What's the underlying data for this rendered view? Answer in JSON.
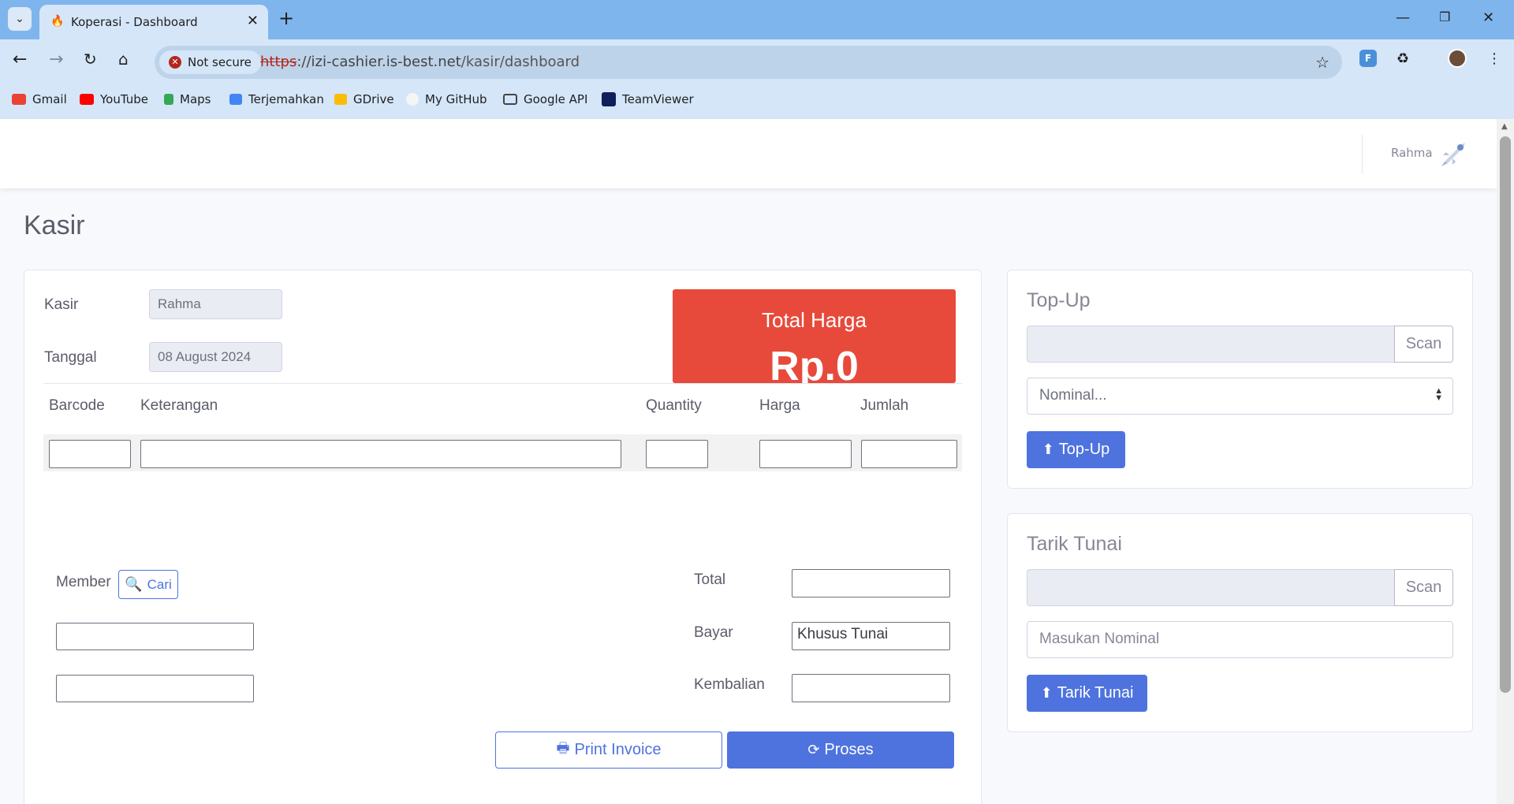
{
  "browser": {
    "tab_title": "Koperasi - Dashboard",
    "url_scheme": "https",
    "url_host": "://izi-cashier.is-best.net",
    "url_path": "/kasir/dashboard",
    "security_label": "Not secure",
    "bookmarks": [
      "Gmail",
      "YouTube",
      "Maps",
      "Terjemahkan",
      "GDrive",
      "My GitHub",
      "Google API",
      "TeamViewer"
    ]
  },
  "topnav": {
    "user_name": "Rahma"
  },
  "page_title": "Kasir",
  "kasir_form": {
    "kasir_label": "Kasir",
    "kasir_value": "Rahma",
    "tanggal_label": "Tanggal",
    "tanggal_value": "08 August 2024",
    "total_harga_label": "Total Harga",
    "total_harga_value": "Rp.0",
    "columns": [
      "Barcode",
      "Keterangan",
      "Quantity",
      "Harga",
      "Jumlah"
    ],
    "member_label": "Member",
    "cari_label": "Cari",
    "total_label": "Total",
    "bayar_label": "Bayar",
    "bayar_value": "Khusus Tunai",
    "kembalian_label": "Kembalian",
    "print_label": "Print Invoice",
    "proses_label": "Proses"
  },
  "topup": {
    "title": "Top-Up",
    "scan_label": "Scan",
    "nominal_selected": "Nominal...",
    "button_label": "Top-Up"
  },
  "tarik": {
    "title": "Tarik Tunai",
    "scan_label": "Scan",
    "nominal_placeholder": "Masukan Nominal",
    "button_label": "Tarik Tunai"
  },
  "colors": {
    "primary": "#4e73df",
    "danger": "#e74a3b"
  }
}
